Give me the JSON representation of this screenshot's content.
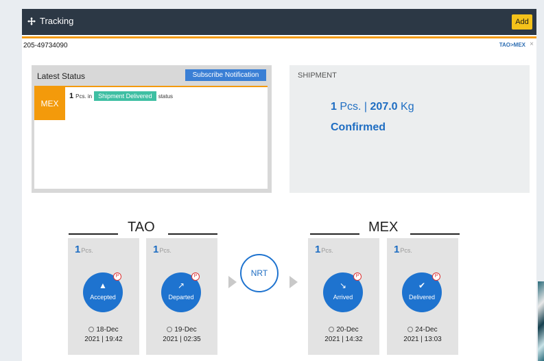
{
  "header": {
    "title": "Tracking",
    "add_label": "Add"
  },
  "awb_number": "205-49734090",
  "route_link": "TAO>MEX",
  "route_close": "×",
  "latest_status": {
    "title": "Latest Status",
    "subscribe_label": "Subscribe Notification",
    "destination": "MEX",
    "pieces": "1",
    "pieces_text": "Pcs. in",
    "badge": "Shipment Delivered",
    "suffix": "status"
  },
  "shipment": {
    "title": "SHIPMENT",
    "pieces": "1",
    "pieces_unit": "Pcs. |",
    "weight": "207.0",
    "weight_unit": "Kg",
    "status": "Confirmed"
  },
  "origin": {
    "code": "TAO"
  },
  "destination": {
    "code": "MEX"
  },
  "transit": {
    "code": "NRT"
  },
  "events": [
    {
      "pcs": "1",
      "pcs_unit": "Pcs.",
      "label": "Accepted",
      "icon": "thumbs-up-icon",
      "date": "18-Dec",
      "time": "2021 | 19:42"
    },
    {
      "pcs": "1",
      "pcs_unit": "Pcs.",
      "label": "Departed",
      "icon": "arrow-up-right-icon",
      "date": "19-Dec",
      "time": "2021 | 02:35"
    },
    {
      "pcs": "1",
      "pcs_unit": "Pcs.",
      "label": "Arrived",
      "icon": "arrow-down-right-icon",
      "date": "20-Dec",
      "time": "2021 | 14:32"
    },
    {
      "pcs": "1",
      "pcs_unit": "Pcs.",
      "label": "Delivered",
      "icon": "check-icon",
      "date": "24-Dec",
      "time": "2021 | 13:03"
    }
  ],
  "colors": {
    "header_bg": "#2c3845",
    "accent_orange": "#f39a0b",
    "primary_blue": "#1e73cf",
    "delivered_green": "#3fbfa3",
    "add_button_yellow": "#f4c21a"
  }
}
